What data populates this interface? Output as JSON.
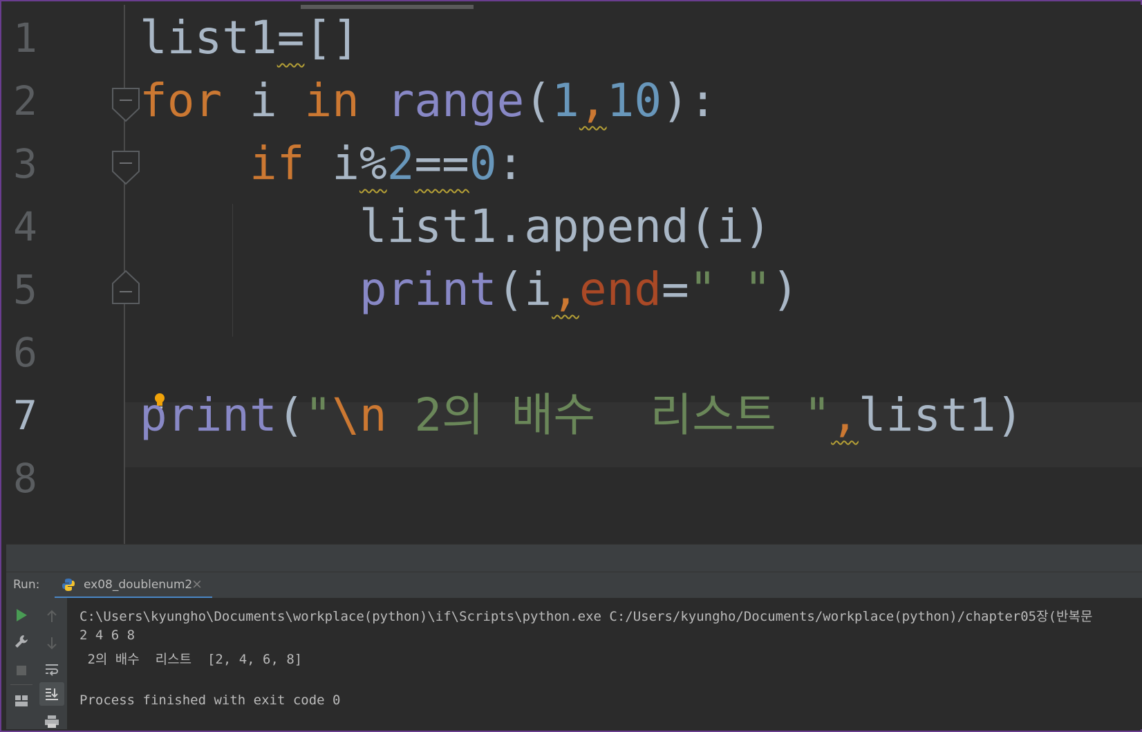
{
  "editor": {
    "line_numbers": [
      "1",
      "2",
      "3",
      "4",
      "5",
      "6",
      "7",
      "8"
    ],
    "active_line": "7",
    "code": {
      "l1": {
        "a": "list1",
        "b": "=",
        "c": "[]"
      },
      "l2": {
        "kw1": "for",
        "var": " i ",
        "kw2": "in",
        "sp": " ",
        "fn": "range",
        "p1": "(",
        "n1": "1",
        "comma": ",",
        "n2": "10",
        "p2": "):"
      },
      "l3": {
        "indent": "    ",
        "kw": "if",
        "sp": " ",
        "v": "i",
        "op": "%",
        "n1": "2",
        "eq": "==",
        "n2": "0",
        "colon": ":"
      },
      "l4": {
        "indent": "        ",
        "text": "list1.append(i)"
      },
      "l5": {
        "indent": "        ",
        "fn": "print",
        "p1": "(i",
        "comma": ",",
        "param": "end",
        "eq": "=",
        "str": "\" \"",
        "p2": ")"
      },
      "l7": {
        "fn": "print",
        "p1": "(",
        "q1": "\"",
        "esc": "\\n",
        "str": " 2의 배수  리스트 \"",
        "comma": ",",
        "rest": "list1)"
      }
    }
  },
  "run_panel": {
    "label": "Run:",
    "tab_label": "ex08_doublenum2",
    "tab_close": "×",
    "console_lines": [
      "C:\\Users\\kyungho\\Documents\\workplace(python)\\if\\Scripts\\python.exe C:/Users/kyungho/Documents/workplace(python)/chapter05장(반복문",
      "2 4 6 8",
      " 2의 배수  리스트  [2, 4, 6, 8]",
      "",
      "Process finished with exit code 0"
    ]
  },
  "icons": {
    "run": "play-icon",
    "settings": "wrench-icon",
    "stop": "stop-icon",
    "layout": "layout-icon",
    "up": "arrow-up-icon",
    "down": "arrow-down-icon",
    "wrap": "soft-wrap-icon",
    "scroll_end": "scroll-to-end-icon",
    "print": "print-icon",
    "python": "python-icon",
    "bulb": "lightbulb-icon"
  },
  "colors": {
    "keyword": "#cc7832",
    "function": "#8888c6",
    "number": "#6897bb",
    "string": "#6a8759",
    "param": "#aa4926",
    "text": "#a9b7c6",
    "run_green": "#499c54"
  }
}
